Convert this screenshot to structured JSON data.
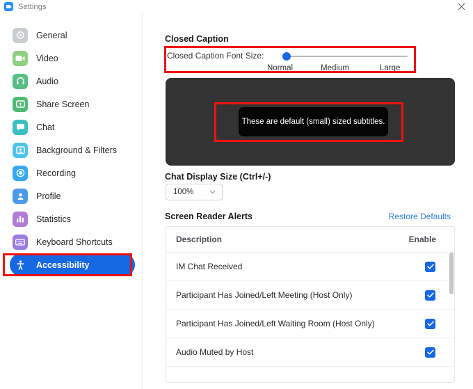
{
  "window": {
    "title": "Settings",
    "logo_icon": "zoom-logo-icon",
    "close_icon": "close-icon"
  },
  "sidebar": {
    "items": [
      {
        "label": "General",
        "icon": "gear-icon",
        "color": "#c9cdd1",
        "selected": false
      },
      {
        "label": "Video",
        "icon": "video-camera-icon",
        "color": "#8ed081",
        "selected": false
      },
      {
        "label": "Audio",
        "icon": "headphones-icon",
        "color": "#57bf83",
        "selected": false
      },
      {
        "label": "Share Screen",
        "icon": "share-screen-icon",
        "color": "#4fba76",
        "selected": false
      },
      {
        "label": "Chat",
        "icon": "chat-bubble-icon",
        "color": "#3bbfc0",
        "selected": false
      },
      {
        "label": "Background & Filters",
        "icon": "person-frame-icon",
        "color": "#4fc3e8",
        "selected": false
      },
      {
        "label": "Recording",
        "icon": "record-circle-icon",
        "color": "#36a8ef",
        "selected": false
      },
      {
        "label": "Profile",
        "icon": "person-icon",
        "color": "#4d9ae8",
        "selected": false
      },
      {
        "label": "Statistics",
        "icon": "bar-chart-icon",
        "color": "#b07cd6",
        "selected": false
      },
      {
        "label": "Keyboard Shortcuts",
        "icon": "keyboard-icon",
        "color": "#9a7ce0",
        "selected": false
      },
      {
        "label": "Accessibility",
        "icon": "accessibility-icon",
        "color": "#1668e3",
        "selected": true
      }
    ]
  },
  "panel": {
    "closed_caption": {
      "title": "Closed Caption",
      "font_size_label": "Closed Caption Font Size:",
      "slider": {
        "ticks": [
          "Normal",
          "Medium",
          "Large"
        ],
        "value": "Normal",
        "value_index": 0
      },
      "preview_text": "These are default (small) sized subtitles."
    },
    "chat_display": {
      "title": "Chat Display Size (Ctrl+/-)",
      "value": "100%",
      "caret_icon": "chevron-down-icon"
    },
    "screen_reader_alerts": {
      "title": "Screen Reader Alerts",
      "restore_defaults": "Restore Defaults",
      "columns": [
        "Description",
        "Enable"
      ],
      "rows": [
        {
          "description": "IM Chat Received",
          "enabled": true
        },
        {
          "description": "Participant Has Joined/Left Meeting (Host Only)",
          "enabled": true
        },
        {
          "description": "Participant Has Joined/Left Waiting Room (Host Only)",
          "enabled": true
        },
        {
          "description": "Audio Muted by Host",
          "enabled": true
        }
      ],
      "check_icon": "checkmark-icon"
    }
  },
  "annotations": {
    "accent_color": "#ee1212",
    "boxes": [
      "closed-caption-font-size-row",
      "subtitle-preview-caption",
      "sidebar-item-accessibility"
    ]
  },
  "colors": {
    "accent_blue": "#1668e3",
    "link_blue": "#2f7cd6",
    "preview_bg": "#333333",
    "caption_bg": "#050505",
    "annotation_red": "#ee1212"
  }
}
